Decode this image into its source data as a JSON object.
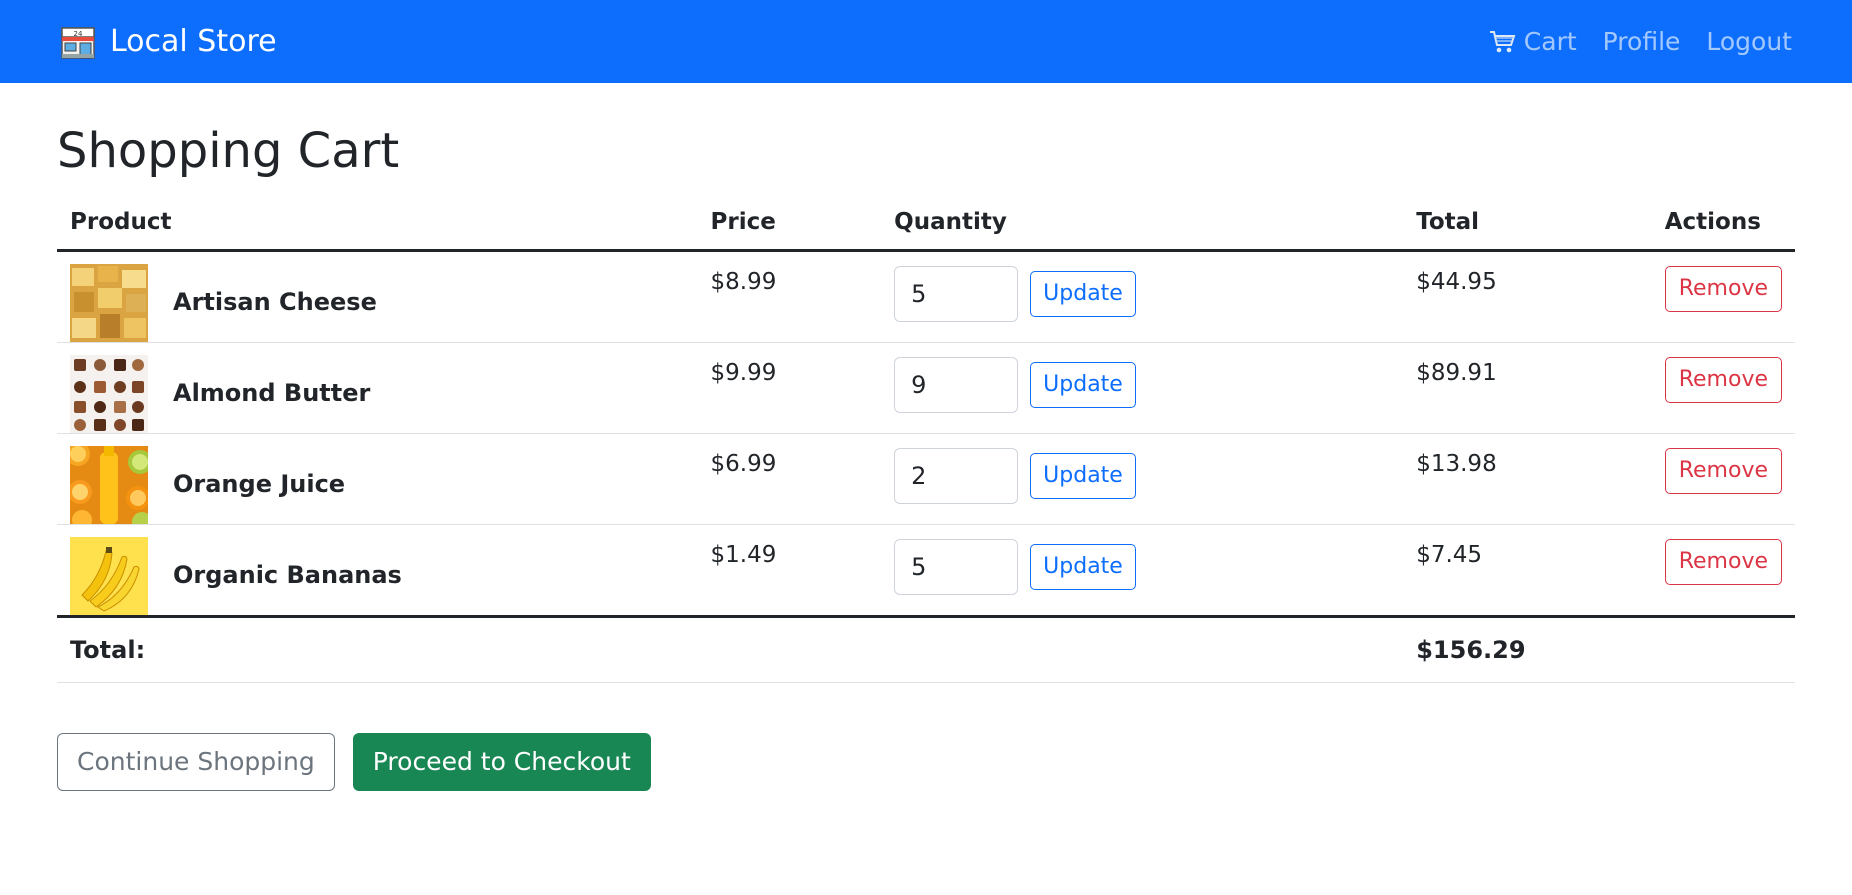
{
  "navbar": {
    "brand": "Local Store",
    "brand_icon": "convenience-store-icon",
    "links": {
      "cart": "Cart",
      "cart_icon": "shopping-cart-icon",
      "profile": "Profile",
      "logout": "Logout"
    },
    "background_color": "#0d6efd"
  },
  "page_title": "Shopping Cart",
  "table": {
    "headers": {
      "product": "Product",
      "price": "Price",
      "quantity": "Quantity",
      "total": "Total",
      "actions": "Actions"
    },
    "rows": [
      {
        "name": "Artisan Cheese",
        "image": "cheese-image",
        "price": "$8.99",
        "quantity": "5",
        "total": "$44.95",
        "update_label": "Update",
        "remove_label": "Remove"
      },
      {
        "name": "Almond Butter",
        "image": "chocolates-image",
        "price": "$9.99",
        "quantity": "9",
        "total": "$89.91",
        "update_label": "Update",
        "remove_label": "Remove"
      },
      {
        "name": "Orange Juice",
        "image": "orange-juice-image",
        "price": "$6.99",
        "quantity": "2",
        "total": "$13.98",
        "update_label": "Update",
        "remove_label": "Remove"
      },
      {
        "name": "Organic Bananas",
        "image": "bananas-image",
        "price": "$1.49",
        "quantity": "5",
        "total": "$7.45",
        "update_label": "Update",
        "remove_label": "Remove"
      }
    ],
    "footer": {
      "label": "Total:",
      "grand_total": "$156.29"
    }
  },
  "buttons": {
    "continue_shopping": "Continue Shopping",
    "proceed_checkout": "Proceed to Checkout"
  },
  "colors": {
    "primary": "#0d6efd",
    "danger": "#dc3545",
    "success": "#198754",
    "secondary": "#6c757d"
  }
}
